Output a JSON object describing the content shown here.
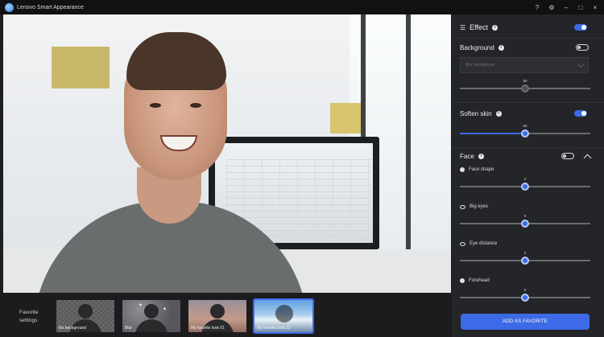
{
  "window": {
    "title": "Lenovo Smart Appearance",
    "controls": [
      "?",
      "⚙",
      "–",
      "□",
      "×"
    ]
  },
  "effect": {
    "title": "Effect",
    "enabled": true
  },
  "background": {
    "title": "Background",
    "enabled": false,
    "dropdown_value": "Blur background",
    "slider_value": "50",
    "slider_fraction": 0.5
  },
  "soften_skin": {
    "title": "Soften skin",
    "enabled": true,
    "slider_value": "50",
    "slider_fraction": 0.5
  },
  "face": {
    "title": "Face",
    "enabled": false,
    "items": [
      {
        "label": "Face shape",
        "value": "0",
        "fraction": 0.5,
        "icon": "face-icon"
      },
      {
        "label": "Big eyes",
        "value": "0",
        "fraction": 0.5,
        "icon": "eye-icon"
      },
      {
        "label": "Eye distance",
        "value": "0",
        "fraction": 0.5,
        "icon": "eye-distance-icon"
      },
      {
        "label": "Forehead",
        "value": "0",
        "fraction": 0.5,
        "icon": "forehead-icon"
      }
    ]
  },
  "favorite_button": "ADD AS FAVORITE",
  "favorites": {
    "label": "Favorite settings",
    "items": [
      {
        "caption": "No background",
        "style": "checker"
      },
      {
        "caption": "Blur",
        "style": "blur"
      },
      {
        "caption": "My favorite look 01",
        "style": "warm"
      },
      {
        "caption": "My favorite look 02",
        "style": "mountain",
        "selected": true
      }
    ]
  },
  "colors": {
    "accent": "#3d6ae6",
    "panel": "#242528",
    "titlebar": "#111113"
  }
}
